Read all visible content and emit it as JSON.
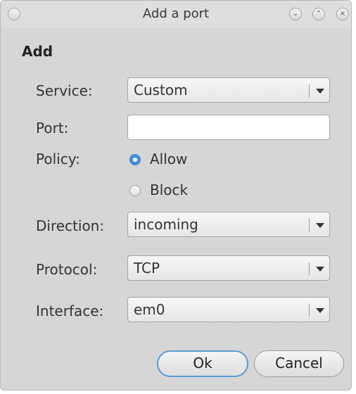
{
  "window": {
    "title": "Add a port",
    "heading": "Add"
  },
  "form": {
    "service": {
      "label": "Service:",
      "value": "Custom"
    },
    "port": {
      "label": "Port:",
      "value": ""
    },
    "policy": {
      "label": "Policy:",
      "options": [
        {
          "label": "Allow",
          "checked": true
        },
        {
          "label": "Block",
          "checked": false
        }
      ]
    },
    "direction": {
      "label": "Direction:",
      "value": "incoming"
    },
    "protocol": {
      "label": "Protocol:",
      "value": "TCP"
    },
    "interface": {
      "label": "Interface:",
      "value": "em0"
    }
  },
  "buttons": {
    "ok": "Ok",
    "cancel": "Cancel"
  },
  "colors": {
    "window_bg": "#d6d6d6",
    "accent": "#4a90d9",
    "default_button_border": "#5b9bd5"
  },
  "icons": {
    "window_menu": "circle-menu-icon",
    "minimize": "chevron-down-icon",
    "maximize": "chevron-up-icon",
    "close": "close-icon"
  }
}
